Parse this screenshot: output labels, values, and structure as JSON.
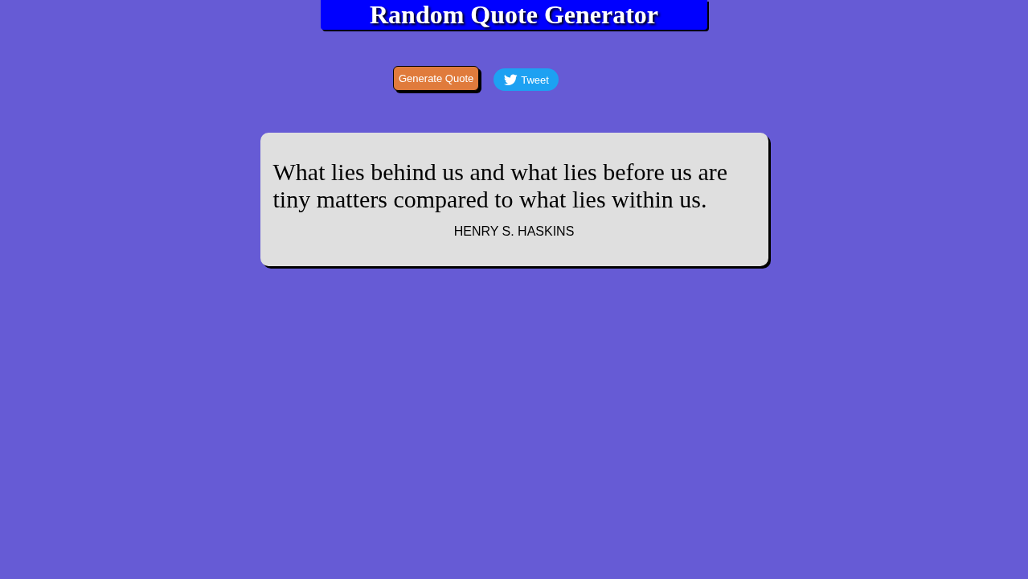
{
  "header": {
    "title": "Random Quote Generator"
  },
  "actions": {
    "generate_button": "Generate Quote",
    "tweet_button": "Tweet"
  },
  "quote_card": {
    "quote": "What lies behind us and what lies before us are tiny matters compared to what lies within us.",
    "author": "HENRY S. HASKINS"
  }
}
